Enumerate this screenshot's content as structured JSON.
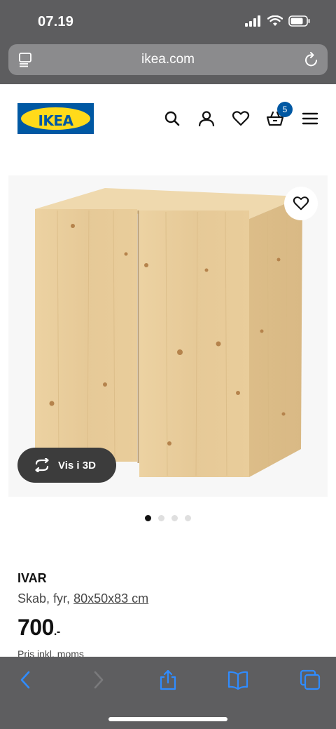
{
  "status_bar": {
    "time": "07.19"
  },
  "browser": {
    "url": "ikea.com"
  },
  "header": {
    "logo_text": "IKEA",
    "cart_count": "5",
    "icons": [
      "search-icon",
      "account-icon",
      "heart-icon",
      "basket-icon",
      "menu-icon"
    ]
  },
  "gallery": {
    "view_3d_label": "Vis i 3D",
    "slide_count": 4,
    "active_slide": 1
  },
  "product": {
    "name": "IVAR",
    "type": "Skab, fyr,",
    "dimensions": "80x50x83 cm",
    "price": "700",
    "price_suffix": ".-",
    "price_note": "Pris inkl. moms"
  },
  "colors": {
    "ikea_blue": "#0058a3",
    "ikea_yellow": "#ffda1a",
    "wood": "#e7cb97"
  }
}
